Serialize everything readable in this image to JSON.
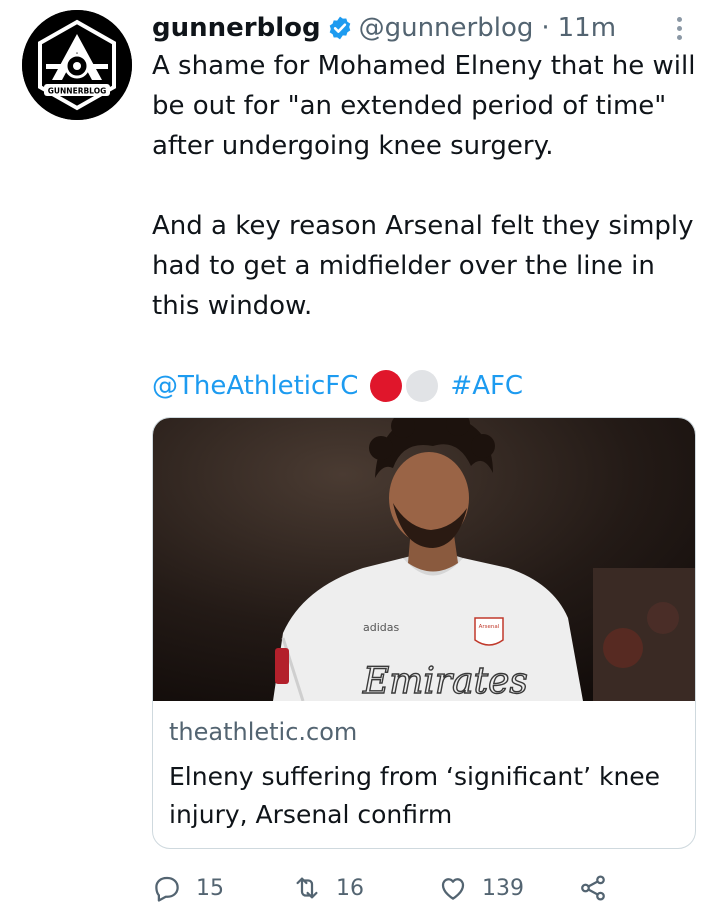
{
  "tweet": {
    "author": {
      "display_name": "gunnerblog",
      "handle": "@gunnerblog",
      "verified": true,
      "avatar_text": "GUNNERBLOG"
    },
    "separator": "·",
    "time": "11m",
    "text_paragraphs": [
      "A shame for Mohamed Elneny that he will be out for \"an extended period of time\" after undergoing knee surgery.",
      "And a key reason Arsenal felt they simply had to get a midfielder over the line in this window."
    ],
    "mention": "@TheAthleticFC",
    "hashtag": "#AFC",
    "link_card": {
      "domain": "theathletic.com",
      "title": "Elneny suffering from ‘significant’ knee injury, Arsenal confirm",
      "image_text": {
        "brand": "adidas",
        "sponsor": "Emirates",
        "badge": "Arsenal"
      }
    },
    "actions": {
      "replies": "15",
      "retweets": "16",
      "likes": "139"
    }
  },
  "icons": {
    "verified": "verified-badge-icon",
    "more": "more-dots-icon",
    "reply": "reply-icon",
    "retweet": "retweet-icon",
    "like": "heart-icon",
    "share": "share-icon"
  },
  "colors": {
    "accent": "#1d9bf0",
    "muted": "#536471",
    "red_circle": "#e0162b",
    "grey_circle": "#e1e3e6"
  }
}
